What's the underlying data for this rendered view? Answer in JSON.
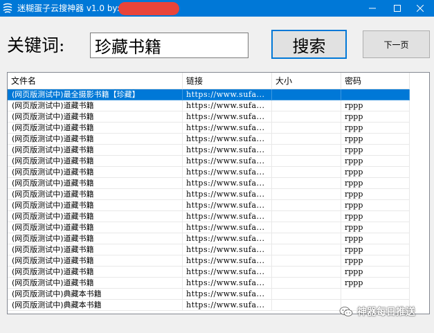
{
  "window": {
    "title": "迷糊蛋子云搜神器 v1.0   by:",
    "accent_color": "#0078d7",
    "icons": {
      "app": "app-logo-icon",
      "minimize": "minimize-icon",
      "maximize": "maximize-icon",
      "close": "close-icon"
    }
  },
  "search": {
    "label": "关键词:",
    "value": "珍藏书籍",
    "search_button": "搜索",
    "next_button": "下一页"
  },
  "table": {
    "columns": [
      "文件名",
      "链接",
      "大小",
      "密码"
    ],
    "selected_index": 0,
    "rows": [
      {
        "name": "(网页版测试中)最全摄影书籍【珍藏】",
        "link": "https://www.sufa...",
        "size": "",
        "password": ""
      },
      {
        "name": "(网页版测试中)道藏书籍",
        "link": "https://www.sufa...",
        "size": "",
        "password": "rppp"
      },
      {
        "name": "(网页版测试中)道藏书籍",
        "link": "https://www.sufa...",
        "size": "",
        "password": "rppp"
      },
      {
        "name": "(网页版测试中)道藏书籍",
        "link": "https://www.sufa...",
        "size": "",
        "password": "rppp"
      },
      {
        "name": "(网页版测试中)道藏书籍",
        "link": "https://www.sufa...",
        "size": "",
        "password": "rppp"
      },
      {
        "name": "(网页版测试中)道藏书籍",
        "link": "https://www.sufa...",
        "size": "",
        "password": "rppp"
      },
      {
        "name": "(网页版测试中)道藏书籍",
        "link": "https://www.sufa...",
        "size": "",
        "password": "rppp"
      },
      {
        "name": "(网页版测试中)道藏书籍",
        "link": "https://www.sufa...",
        "size": "",
        "password": "rppp"
      },
      {
        "name": "(网页版测试中)道藏书籍",
        "link": "https://www.sufa...",
        "size": "",
        "password": "rppp"
      },
      {
        "name": "(网页版测试中)道藏书籍",
        "link": "https://www.sufa...",
        "size": "",
        "password": "rppp"
      },
      {
        "name": "(网页版测试中)道藏书籍",
        "link": "https://www.sufa...",
        "size": "",
        "password": "rppp"
      },
      {
        "name": "(网页版测试中)道藏书籍",
        "link": "https://www.sufa...",
        "size": "",
        "password": "rppp"
      },
      {
        "name": "(网页版测试中)道藏书籍",
        "link": "https://www.sufa...",
        "size": "",
        "password": "rppp"
      },
      {
        "name": "(网页版测试中)道藏书籍",
        "link": "https://www.sufa...",
        "size": "",
        "password": "rppp"
      },
      {
        "name": "(网页版测试中)道藏书籍",
        "link": "https://www.sufa...",
        "size": "",
        "password": "rppp"
      },
      {
        "name": "(网页版测试中)道藏书籍",
        "link": "https://www.sufa...",
        "size": "",
        "password": "rppp"
      },
      {
        "name": "(网页版测试中)道藏书籍",
        "link": "https://www.sufa...",
        "size": "",
        "password": "rppp"
      },
      {
        "name": "(网页版测试中)道藏书籍",
        "link": "https://www.sufa...",
        "size": "",
        "password": "rppp"
      },
      {
        "name": "(网页版测试中)典藏本书籍",
        "link": "https://www.sufa...",
        "size": "",
        "password": ""
      },
      {
        "name": "(网页版测试中)典藏本书籍",
        "link": "https://www.sufa...",
        "size": "",
        "password": ""
      }
    ]
  },
  "watermark": {
    "text": "神器每日推送",
    "icon": "wechat-icon"
  }
}
